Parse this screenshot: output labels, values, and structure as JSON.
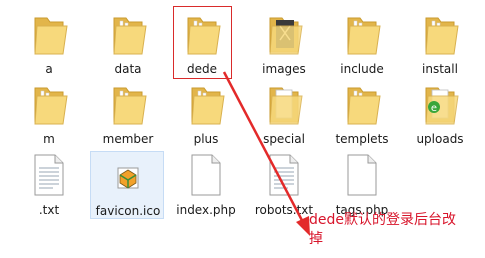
{
  "items": [
    {
      "name": "a",
      "icon": "folder-icon"
    },
    {
      "name": "data",
      "icon": "folder-icon"
    },
    {
      "name": "dede",
      "icon": "folder-icon"
    },
    {
      "name": "images",
      "icon": "folder-with-images-icon"
    },
    {
      "name": "include",
      "icon": "folder-icon"
    },
    {
      "name": "install",
      "icon": "folder-icon"
    },
    {
      "name": "m",
      "icon": "folder-icon"
    },
    {
      "name": "member",
      "icon": "folder-icon"
    },
    {
      "name": "plus",
      "icon": "folder-icon"
    },
    {
      "name": "special",
      "icon": "folder-with-document-icon"
    },
    {
      "name": "templets",
      "icon": "folder-icon"
    },
    {
      "name": "uploads",
      "icon": "folder-with-ie-icon"
    },
    {
      "name": ".txt",
      "icon": "text-file-icon"
    },
    {
      "name": "favicon.ico",
      "icon": "ico-file-icon"
    },
    {
      "name": "index.php",
      "icon": "blank-file-icon"
    },
    {
      "name": "robots.txt",
      "icon": "text-file-icon"
    },
    {
      "name": "tags.php",
      "icon": "blank-file-icon"
    }
  ],
  "annotation": {
    "text": "dede默认的登录后台改掉",
    "color": "#d8152b"
  },
  "colors": {
    "folder_back": "#e6b94f",
    "folder_front": "#f7d97c",
    "selection_border": "#d92b2b",
    "hover_bg": "#e8f1fb"
  }
}
